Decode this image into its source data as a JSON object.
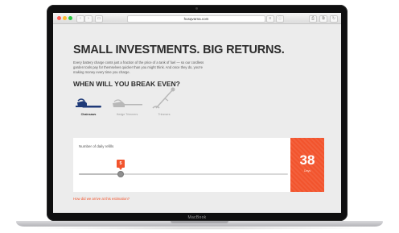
{
  "device": {
    "brand": "MacBook"
  },
  "browser": {
    "url": "husqvarna.com",
    "back_glyph": "‹",
    "forward_glyph": "›",
    "sidebar_glyph": "▭",
    "share_glyph": "⎙",
    "tabs_glyph": "⧉",
    "reader_glyph": "≡",
    "info_glyph": "ⓘ",
    "reload_glyph": "↻"
  },
  "page": {
    "title": "SMALL INVESTMENTS. BIG RETURNS.",
    "body": "Every battery charge costs just a fraction of the price of a tank of fuel — so our cordless garden tools pay for themselves quicker than you might think. And once they do, you're making money every time you charge.",
    "subtitle": "WHEN WILL YOU BREAK EVEN?",
    "tools": [
      {
        "label": "Chainsaws",
        "icon": "chainsaw-icon",
        "active": true
      },
      {
        "label": "Hedge Trimmers",
        "icon": "hedge-trimmer-icon",
        "active": false
      },
      {
        "label": "Trimmers",
        "icon": "trimmer-icon",
        "active": false
      }
    ],
    "slider": {
      "label": "Number of daily refills",
      "value": "5",
      "fraction": 0.2
    },
    "result": {
      "number": "38",
      "unit": "Days"
    },
    "link": "How did we arrive at this estimation?"
  },
  "colors": {
    "accent": "#f2542d",
    "active_tool": "#1f3a78",
    "inactive_tool": "#b8b8b8",
    "heading": "#2c2c2c"
  }
}
